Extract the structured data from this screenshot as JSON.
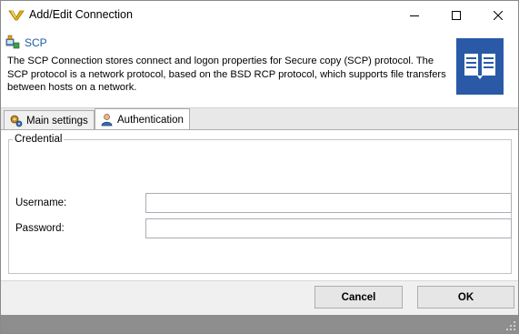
{
  "window": {
    "title": "Add/Edit Connection",
    "controls": {
      "minimize": "minimize",
      "maximize": "maximize",
      "close": "close"
    }
  },
  "header": {
    "protocol_title": "SCP",
    "description": "The SCP Connection stores connect and logon properties for Secure copy (SCP) protocol. The SCP protocol is a network protocol, based on the BSD RCP protocol, which supports file transfers between hosts on a network.",
    "tile_icon": "book-icon",
    "tile_color": "#2a5aa7"
  },
  "tabs": [
    {
      "label": "Main settings",
      "icon": "gears-icon",
      "active": false
    },
    {
      "label": "Authentication",
      "icon": "user-icon",
      "active": true
    }
  ],
  "credential": {
    "group_title": "Credential",
    "username_label": "Username:",
    "username_value": "",
    "password_label": "Password:",
    "password_value": ""
  },
  "footer": {
    "cancel_label": "Cancel",
    "ok_label": "OK"
  },
  "colors": {
    "accent_text": "#1e5aa8",
    "statusbar": "#8e8e8e"
  }
}
